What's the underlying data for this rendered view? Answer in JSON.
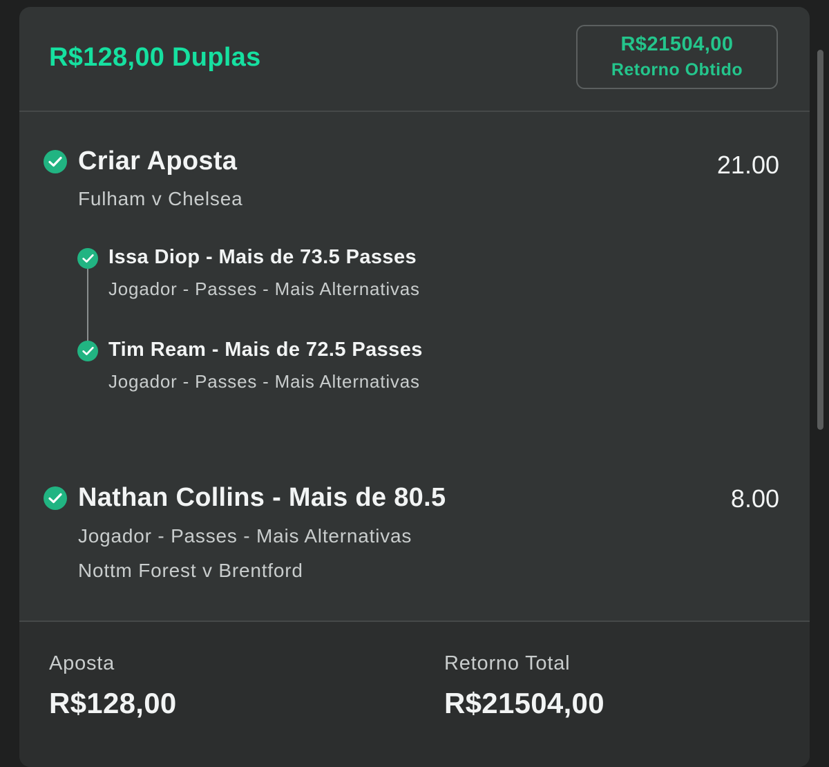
{
  "header": {
    "title": "R$128,00 Duplas",
    "return_amount": "R$21504,00",
    "return_label": "Retorno Obtido"
  },
  "selections": [
    {
      "title": "Criar Aposta",
      "odds": "21.00",
      "event": "Fulham v Chelsea",
      "status_icon": "check-circle-icon",
      "legs": [
        {
          "title": "Issa Diop - Mais de 73.5 Passes",
          "market": "Jogador - Passes - Mais Alternativas",
          "status_icon": "check-circle-icon"
        },
        {
          "title": "Tim Ream - Mais de 72.5 Passes",
          "market": "Jogador - Passes - Mais Alternativas",
          "status_icon": "check-circle-icon"
        }
      ]
    },
    {
      "title": "Nathan Collins - Mais de 80.5",
      "odds": "8.00",
      "market": "Jogador - Passes - Mais Alternativas",
      "event": "Nottm Forest v Brentford",
      "status_icon": "check-circle-icon"
    }
  ],
  "footer": {
    "stake_label": "Aposta",
    "stake_value": "R$128,00",
    "total_return_label": "Retorno Total",
    "total_return_value": "R$21504,00"
  },
  "colors": {
    "accent_green": "#16e0a0",
    "check_green": "#21b482",
    "card_background": "#323535",
    "page_background": "#1f2020"
  }
}
